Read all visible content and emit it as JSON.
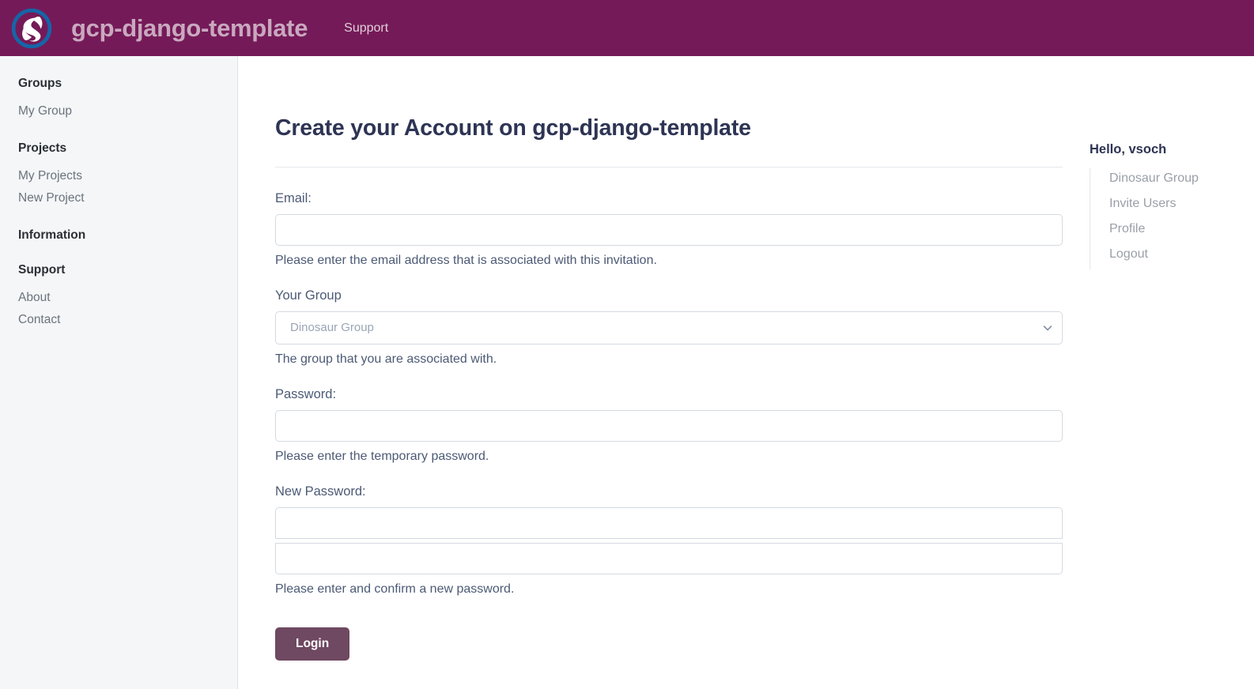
{
  "navbar": {
    "logo_icon": "swirl-logo-icon",
    "brand_title": "gcp-django-template",
    "links": [
      {
        "label": "Support"
      }
    ]
  },
  "sidebar": {
    "groups": [
      {
        "heading": "Groups",
        "items": [
          {
            "label": "My Group"
          }
        ]
      },
      {
        "heading": "Projects",
        "items": [
          {
            "label": "My Projects"
          },
          {
            "label": "New Project"
          }
        ]
      },
      {
        "heading": "Information",
        "items": []
      },
      {
        "heading": "Support",
        "items": [
          {
            "label": "About"
          },
          {
            "label": "Contact"
          }
        ]
      }
    ]
  },
  "main": {
    "page_title": "Create your Account on gcp-django-template",
    "fields": {
      "email": {
        "label": "Email:",
        "value": "",
        "placeholder": "",
        "help": "Please enter the email address that is associated with this invitation."
      },
      "group": {
        "label": "Your Group",
        "selected": "Dinosaur Group",
        "options": [
          "Dinosaur Group"
        ],
        "help": "The group that you are associated with.",
        "chevron_icon": "chevron-down-icon"
      },
      "password": {
        "label": "Password:",
        "value": "",
        "placeholder": "",
        "help": "Please enter the temporary password."
      },
      "new_password": {
        "label": "New Password:",
        "value": "",
        "placeholder": "",
        "confirm_value": "",
        "confirm_placeholder": "",
        "help": "Please enter and confirm a new password."
      }
    },
    "submit_label": "Login"
  },
  "right_rail": {
    "greeting": "Hello, vsoch",
    "items": [
      {
        "label": "Dinosaur Group"
      },
      {
        "label": "Invite Users"
      },
      {
        "label": "Profile"
      },
      {
        "label": "Logout"
      }
    ]
  },
  "colors": {
    "navbar_bg": "#751a58",
    "brand_text": "#c9a8bf",
    "sidebar_bg": "#f4f6f8",
    "heading_text": "#2e3454",
    "label_text": "#4c5a75",
    "button_bg": "#6f4861",
    "logo_ring": "#1565a8",
    "logo_fill": "#ffffff"
  }
}
